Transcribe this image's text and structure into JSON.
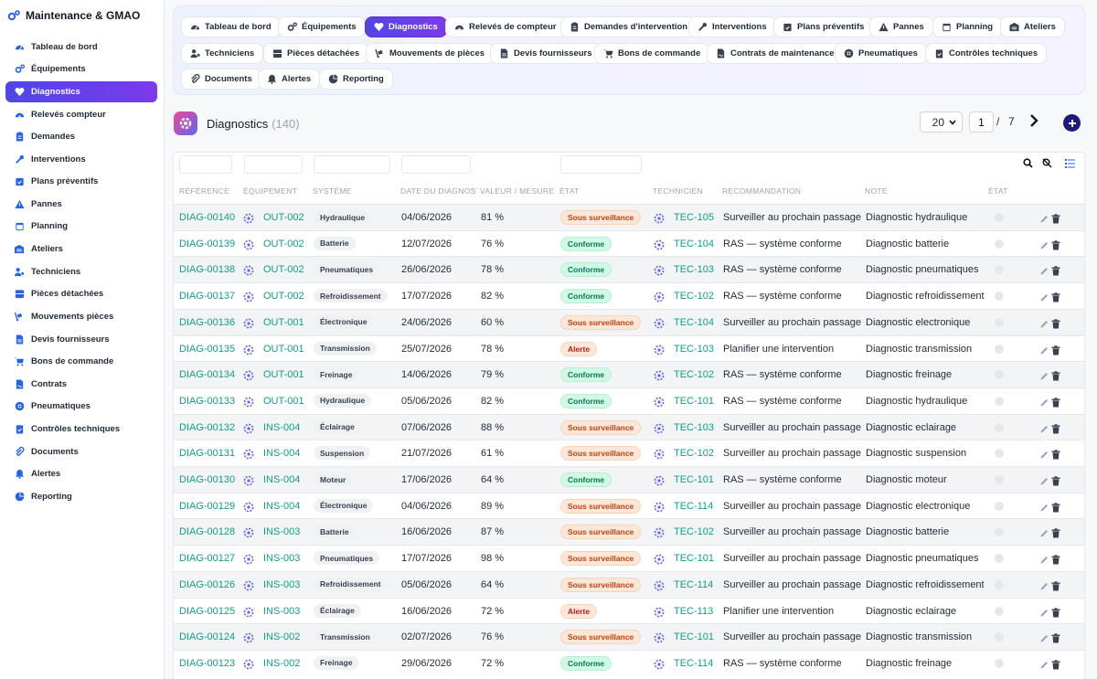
{
  "app": {
    "title": "Maintenance & GMAO"
  },
  "sidebar": {
    "items": [
      {
        "label": "Tableau de bord",
        "icon": "dashboard-icon"
      },
      {
        "label": "Équipements",
        "icon": "cogs-icon"
      },
      {
        "label": "Diagnostics",
        "icon": "heartbeat-icon",
        "active": true
      },
      {
        "label": "Relevés compteur",
        "icon": "gauge-icon"
      },
      {
        "label": "Demandes",
        "icon": "clipboard-icon"
      },
      {
        "label": "Interventions",
        "icon": "wrench-icon"
      },
      {
        "label": "Plans préventifs",
        "icon": "calendar-check-icon"
      },
      {
        "label": "Pannes",
        "icon": "warning-icon"
      },
      {
        "label": "Planning",
        "icon": "calendar-icon"
      },
      {
        "label": "Ateliers",
        "icon": "warehouse-icon"
      },
      {
        "label": "Techniciens",
        "icon": "users-cog-icon"
      },
      {
        "label": "Pièces détachées",
        "icon": "boxes-icon"
      },
      {
        "label": "Mouvements pièces",
        "icon": "dolly-icon"
      },
      {
        "label": "Devis fournisseurs",
        "icon": "file-invoice-icon"
      },
      {
        "label": "Bons de commande",
        "icon": "cart-icon"
      },
      {
        "label": "Contrats",
        "icon": "contract-icon"
      },
      {
        "label": "Pneumatiques",
        "icon": "tire-icon"
      },
      {
        "label": "Contrôles techniques",
        "icon": "clipboard-check-icon"
      },
      {
        "label": "Documents",
        "icon": "paperclip-icon"
      },
      {
        "label": "Alertes",
        "icon": "bell-icon"
      },
      {
        "label": "Reporting",
        "icon": "pie-chart-icon"
      }
    ]
  },
  "topnav": {
    "tabs": [
      {
        "label": "Tableau de bord",
        "icon": "dashboard-icon"
      },
      {
        "label": "Équipements",
        "icon": "cogs-icon"
      },
      {
        "label": "Diagnostics",
        "icon": "heartbeat-icon",
        "active": true
      },
      {
        "label": "Relevés de compteur",
        "icon": "gauge-icon"
      },
      {
        "label": "Demandes d'intervention",
        "icon": "clipboard-icon"
      },
      {
        "label": "Interventions",
        "icon": "wrench-icon"
      },
      {
        "label": "Plans préventifs",
        "icon": "calendar-check-icon"
      },
      {
        "label": "Pannes",
        "icon": "warning-icon"
      },
      {
        "label": "Planning",
        "icon": "calendar-icon"
      },
      {
        "label": "Ateliers",
        "icon": "warehouse-icon"
      },
      {
        "label": "Techniciens",
        "icon": "users-cog-icon"
      },
      {
        "label": "Pièces détachées",
        "icon": "boxes-icon"
      },
      {
        "label": "Mouvements de pièces",
        "icon": "dolly-icon"
      },
      {
        "label": "Devis fournisseurs",
        "icon": "file-invoice-icon"
      },
      {
        "label": "Bons de commande",
        "icon": "cart-icon"
      },
      {
        "label": "Contrats de maintenance",
        "icon": "contract-icon"
      },
      {
        "label": "Pneumatiques",
        "icon": "tire-icon"
      },
      {
        "label": "Contrôles techniques",
        "icon": "clipboard-check-icon"
      },
      {
        "label": "Documents",
        "icon": "paperclip-icon"
      },
      {
        "label": "Alertes",
        "icon": "bell-icon"
      },
      {
        "label": "Reporting",
        "icon": "pie-chart-icon"
      }
    ]
  },
  "page": {
    "title": "Diagnostics",
    "count": "(140)"
  },
  "pagination": {
    "page_size": "20",
    "current_page": "1",
    "separator": "/",
    "total_pages": "7"
  },
  "table": {
    "columns": [
      "RÉFÉRENCE",
      "ÉQUIPEMENT",
      "SYSTÈME",
      "DATE DU DIAGNOSTIC",
      "VALEUR / MESURE",
      "ÉTAT",
      "TECHNICIEN",
      "RECOMMANDATION",
      "NOTE",
      "ÉTAT"
    ],
    "rows": [
      {
        "ref": "DIAG-00140",
        "equip": "OUT-002",
        "system": "Hydraulique",
        "date": "04/06/2026",
        "value": "81 %",
        "state": "Sous surveillance",
        "tech": "TEC-105",
        "reco": "Surveiller au prochain passage",
        "note": "Diagnostic hydraulique"
      },
      {
        "ref": "DIAG-00139",
        "equip": "OUT-002",
        "system": "Batterie",
        "date": "12/07/2026",
        "value": "76 %",
        "state": "Conforme",
        "tech": "TEC-104",
        "reco": "RAS — système conforme",
        "note": "Diagnostic batterie"
      },
      {
        "ref": "DIAG-00138",
        "equip": "OUT-002",
        "system": "Pneumatiques",
        "date": "26/06/2026",
        "value": "78 %",
        "state": "Conforme",
        "tech": "TEC-103",
        "reco": "RAS — système conforme",
        "note": "Diagnostic pneumatiques"
      },
      {
        "ref": "DIAG-00137",
        "equip": "OUT-002",
        "system": "Refroidissement",
        "date": "17/07/2026",
        "value": "82 %",
        "state": "Conforme",
        "tech": "TEC-102",
        "reco": "RAS — système conforme",
        "note": "Diagnostic refroidissement"
      },
      {
        "ref": "DIAG-00136",
        "equip": "OUT-001",
        "system": "Électronique",
        "date": "24/06/2026",
        "value": "60 %",
        "state": "Sous surveillance",
        "tech": "TEC-104",
        "reco": "Surveiller au prochain passage",
        "note": "Diagnostic electronique"
      },
      {
        "ref": "DIAG-00135",
        "equip": "OUT-001",
        "system": "Transmission",
        "date": "25/07/2026",
        "value": "78 %",
        "state": "Alerte",
        "tech": "TEC-103",
        "reco": "Planifier une intervention",
        "note": "Diagnostic transmission"
      },
      {
        "ref": "DIAG-00134",
        "equip": "OUT-001",
        "system": "Freinage",
        "date": "14/06/2026",
        "value": "79 %",
        "state": "Conforme",
        "tech": "TEC-102",
        "reco": "RAS — système conforme",
        "note": "Diagnostic freinage"
      },
      {
        "ref": "DIAG-00133",
        "equip": "OUT-001",
        "system": "Hydraulique",
        "date": "05/06/2026",
        "value": "82 %",
        "state": "Conforme",
        "tech": "TEC-101",
        "reco": "RAS — système conforme",
        "note": "Diagnostic hydraulique"
      },
      {
        "ref": "DIAG-00132",
        "equip": "INS-004",
        "system": "Éclairage",
        "date": "07/06/2026",
        "value": "88 %",
        "state": "Sous surveillance",
        "tech": "TEC-103",
        "reco": "Surveiller au prochain passage",
        "note": "Diagnostic eclairage"
      },
      {
        "ref": "DIAG-00131",
        "equip": "INS-004",
        "system": "Suspension",
        "date": "21/07/2026",
        "value": "61 %",
        "state": "Sous surveillance",
        "tech": "TEC-102",
        "reco": "Surveiller au prochain passage",
        "note": "Diagnostic suspension"
      },
      {
        "ref": "DIAG-00130",
        "equip": "INS-004",
        "system": "Moteur",
        "date": "17/06/2026",
        "value": "64 %",
        "state": "Conforme",
        "tech": "TEC-101",
        "reco": "RAS — système conforme",
        "note": "Diagnostic moteur"
      },
      {
        "ref": "DIAG-00129",
        "equip": "INS-004",
        "system": "Électronique",
        "date": "04/06/2026",
        "value": "89 %",
        "state": "Sous surveillance",
        "tech": "TEC-114",
        "reco": "Surveiller au prochain passage",
        "note": "Diagnostic electronique"
      },
      {
        "ref": "DIAG-00128",
        "equip": "INS-003",
        "system": "Batterie",
        "date": "16/06/2026",
        "value": "87 %",
        "state": "Sous surveillance",
        "tech": "TEC-102",
        "reco": "Surveiller au prochain passage",
        "note": "Diagnostic batterie"
      },
      {
        "ref": "DIAG-00127",
        "equip": "INS-003",
        "system": "Pneumatiques",
        "date": "17/07/2026",
        "value": "98 %",
        "state": "Sous surveillance",
        "tech": "TEC-101",
        "reco": "Surveiller au prochain passage",
        "note": "Diagnostic pneumatiques"
      },
      {
        "ref": "DIAG-00126",
        "equip": "INS-003",
        "system": "Refroidissement",
        "date": "05/06/2026",
        "value": "64 %",
        "state": "Sous surveillance",
        "tech": "TEC-114",
        "reco": "Surveiller au prochain passage",
        "note": "Diagnostic refroidissement"
      },
      {
        "ref": "DIAG-00125",
        "equip": "INS-003",
        "system": "Éclairage",
        "date": "16/06/2026",
        "value": "72 %",
        "state": "Alerte",
        "tech": "TEC-113",
        "reco": "Planifier une intervention",
        "note": "Diagnostic eclairage"
      },
      {
        "ref": "DIAG-00124",
        "equip": "INS-002",
        "system": "Transmission",
        "date": "02/07/2026",
        "value": "76 %",
        "state": "Sous surveillance",
        "tech": "TEC-101",
        "reco": "Surveiller au prochain passage",
        "note": "Diagnostic transmission"
      },
      {
        "ref": "DIAG-00123",
        "equip": "INS-002",
        "system": "Freinage",
        "date": "29/06/2026",
        "value": "72 %",
        "state": "Conforme",
        "tech": "TEC-114",
        "reco": "RAS — système conforme",
        "note": "Diagnostic freinage"
      }
    ]
  },
  "colors": {
    "accent": "#5b4be0",
    "link": "#0e9f86",
    "ok": "#047857",
    "warn": "#c2410c",
    "alert": "#b91c1c"
  }
}
